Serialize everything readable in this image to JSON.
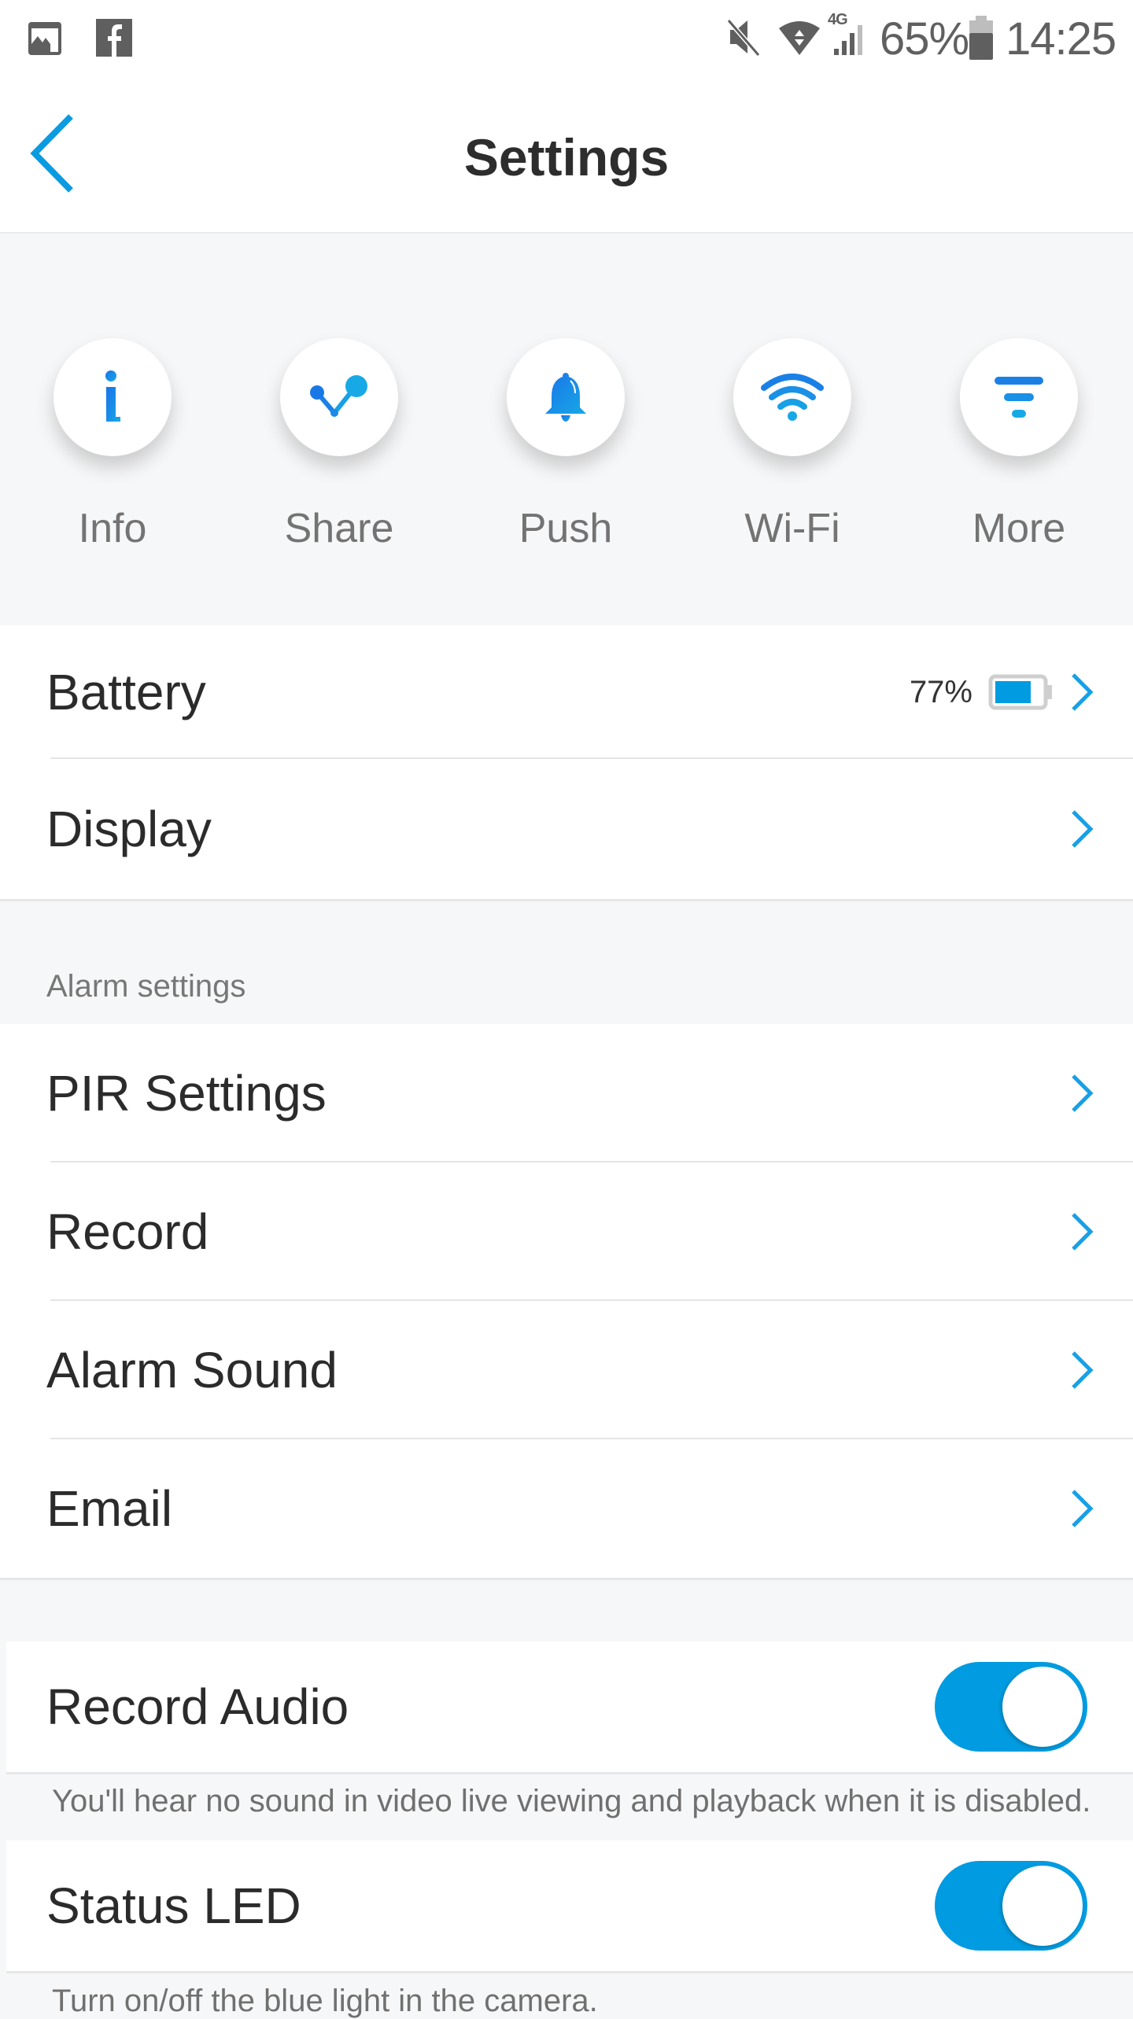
{
  "status_bar": {
    "left_icons": [
      "gallery-icon",
      "facebook-icon"
    ],
    "right_icons": [
      "mute-icon",
      "wifi-data-icon",
      "signal-4g-icon",
      "battery-icon"
    ],
    "network_label": "4G",
    "battery_percent": "65%",
    "time": "14:25"
  },
  "header": {
    "back_icon": "chevron-left-icon",
    "title": "Settings"
  },
  "quick_actions": [
    {
      "label": "Info",
      "icon": "info-icon"
    },
    {
      "label": "Share",
      "icon": "share-icon"
    },
    {
      "label": "Push",
      "icon": "bell-icon"
    },
    {
      "label": "Wi-Fi",
      "icon": "wifi-icon"
    },
    {
      "label": "More",
      "icon": "filter-icon"
    }
  ],
  "general": [
    {
      "label": "Battery",
      "value": "77%",
      "battery_level": 0.77
    },
    {
      "label": "Display"
    }
  ],
  "alarm_section": {
    "title": "Alarm settings",
    "items": [
      {
        "label": "PIR Settings"
      },
      {
        "label": "Record"
      },
      {
        "label": "Alarm Sound"
      },
      {
        "label": "Email"
      }
    ]
  },
  "toggles": [
    {
      "label": "Record Audio",
      "enabled": true,
      "hint": "You'll hear no sound in video live viewing and playback when it is disabled."
    },
    {
      "label": "Status LED",
      "enabled": true,
      "hint": "Turn on/off the blue light in the camera."
    }
  ],
  "colors": {
    "accent": "#009be0",
    "background": "#f6f7f8",
    "text_primary": "#2b2b2b",
    "text_secondary": "#737373"
  }
}
